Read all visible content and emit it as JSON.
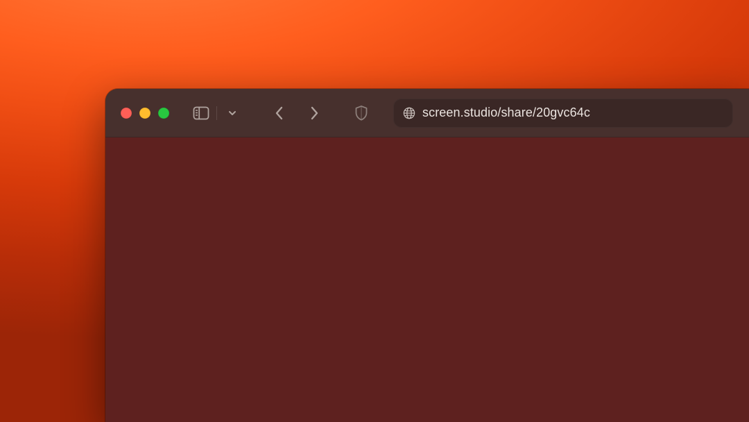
{
  "address_bar": {
    "url": "screen.studio/share/20gvc64c"
  },
  "colors": {
    "toolbar_bg": "#47302d",
    "content_bg": "#5e211f",
    "address_bg": "#3a2725",
    "text": "#eae3df"
  }
}
